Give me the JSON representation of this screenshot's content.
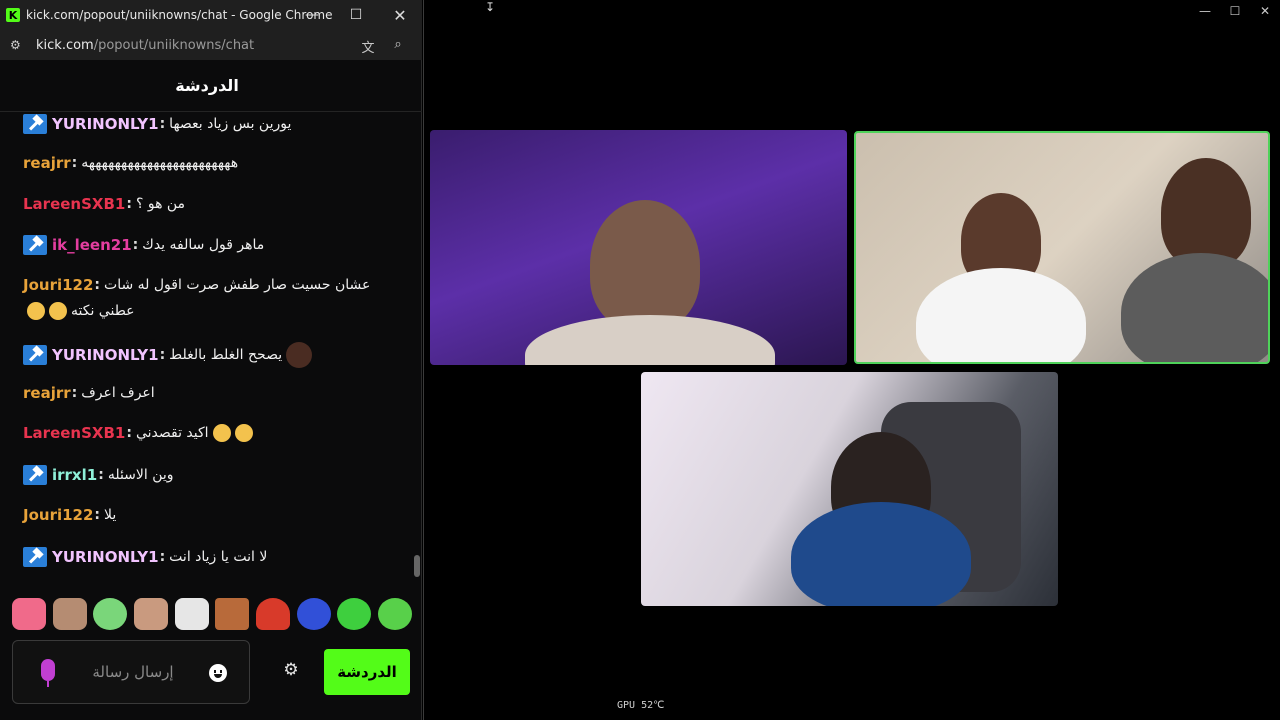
{
  "chat_window": {
    "title": "kick.com/popout/uniiknowns/chat - Google Chrome",
    "url_host": "kick.com",
    "url_path": "/popout/uniiknowns/chat",
    "header_title": "الدردشة",
    "messages": [
      {
        "user": "YURINONLY1",
        "color": "#f2c4ff",
        "badge": true,
        "text": "يورين بس زياد بعصها"
      },
      {
        "user": "reajrr",
        "color": "#e8a33a",
        "badge": false,
        "text": "هههههههههههههههههههههههه"
      },
      {
        "user": "LareenSXB1",
        "color": "#e8344f",
        "badge": false,
        "text": "من هو ؟"
      },
      {
        "user": "ik_leen21",
        "color": "#e43ea0",
        "badge": true,
        "text": "ماهر قول سالفه يدك"
      },
      {
        "user": "Jouri122",
        "color": "#e8a33a",
        "badge": false,
        "text": "عشان حسيت صار طفش صرت اقول له شات",
        "text2": "عطني نكته"
      },
      {
        "user": "YURINONLY1",
        "color": "#f2c4ff",
        "badge": true,
        "text": "يصحح الغلط بالغلط"
      },
      {
        "user": "reajrr",
        "color": "#e8a33a",
        "badge": false,
        "text": "اعرف اعرف"
      },
      {
        "user": "LareenSXB1",
        "color": "#e8344f",
        "badge": false,
        "text": "اكيد تقصدني"
      },
      {
        "user": "irrxl1",
        "color": "#8ff0d8",
        "badge": true,
        "text": "وين الاسئله"
      },
      {
        "user": "Jouri122",
        "color": "#e8a33a",
        "badge": false,
        "text": "يلا"
      },
      {
        "user": "YURINONLY1",
        "color": "#f2c4ff",
        "badge": true,
        "text": "لا انت يا زياد انت"
      }
    ],
    "input_placeholder": "إرسال رسالة",
    "send_label": "الدردشة"
  },
  "emotes": [
    "pink-blob-emote",
    "old-man-emote",
    "clown-emote",
    "face-emote",
    "sunglasses-emote",
    "angry-emote",
    "mushroom-emote",
    "bot-emote",
    "green-smile-emote",
    "angel-emote"
  ],
  "gpu_readout": "GPU 52℃",
  "colors": {
    "kick_green": "#53fc18",
    "active_speaker": "#4fd25a",
    "mic": "#c13fd2"
  }
}
